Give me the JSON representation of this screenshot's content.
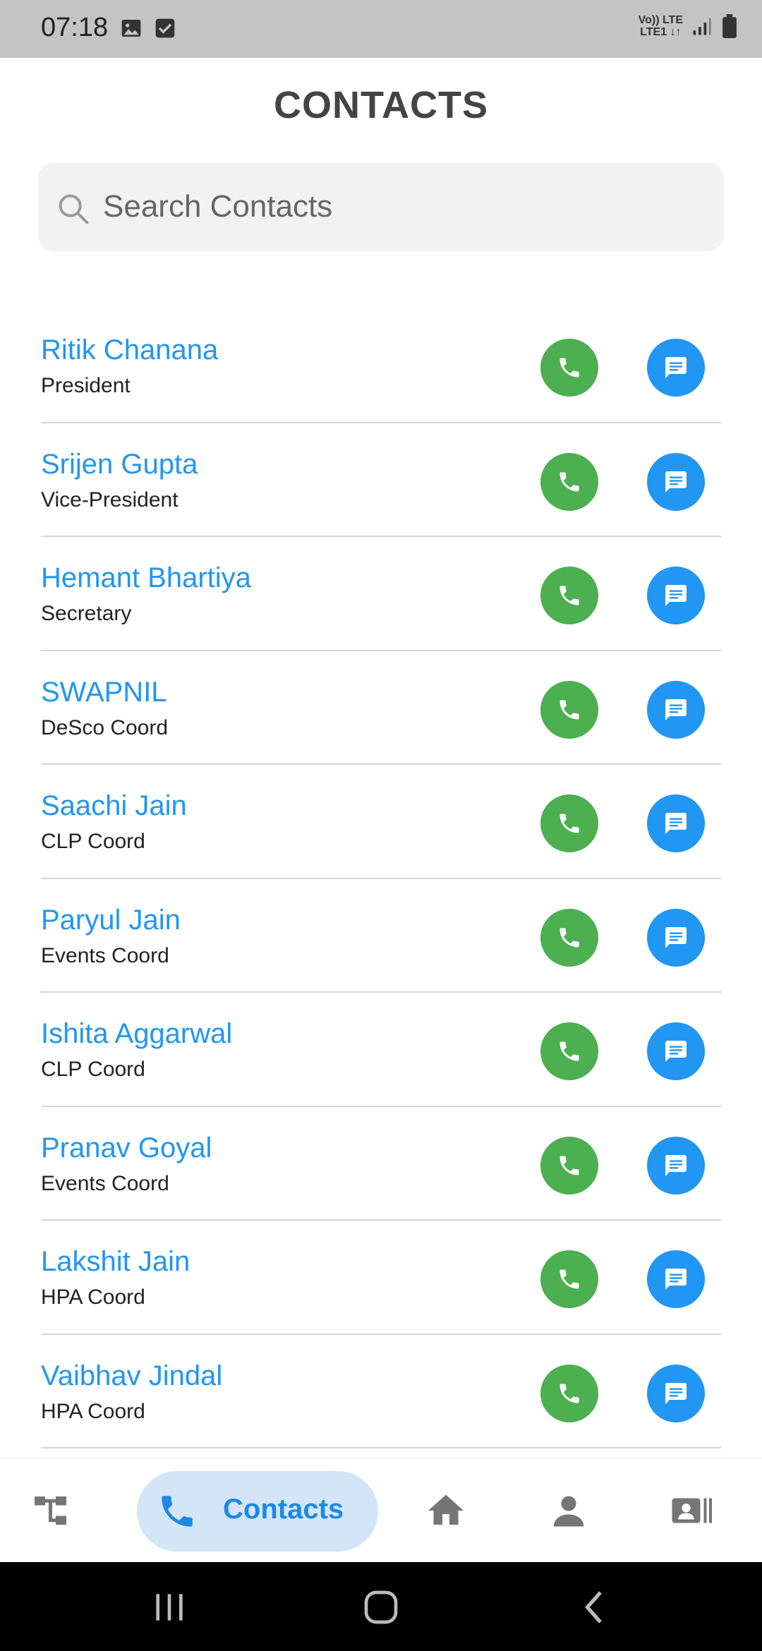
{
  "status_bar": {
    "time": "07:18",
    "left_icons": [
      "image-icon",
      "checkbox-icon"
    ],
    "network_line1": "Vo)) LTE",
    "network_line2": "LTE1 ↓↑",
    "right_icons": [
      "signal-icon",
      "battery-icon"
    ]
  },
  "header": {
    "title": "CONTACTS"
  },
  "search": {
    "placeholder": "Search Contacts",
    "value": ""
  },
  "contacts": [
    {
      "name": "Ritik Chanana",
      "role": "President"
    },
    {
      "name": "Srijen Gupta",
      "role": "Vice-President"
    },
    {
      "name": "Hemant Bhartiya",
      "role": "Secretary"
    },
    {
      "name": "SWAPNIL",
      "role": "DeSco Coord"
    },
    {
      "name": "Saachi Jain",
      "role": "CLP Coord"
    },
    {
      "name": "Paryul Jain",
      "role": "Events Coord"
    },
    {
      "name": "Ishita Aggarwal",
      "role": "CLP Coord"
    },
    {
      "name": "Pranav Goyal",
      "role": "Events Coord"
    },
    {
      "name": "Lakshit Jain",
      "role": "HPA Coord"
    },
    {
      "name": "Vaibhav Jindal",
      "role": "HPA Coord"
    }
  ],
  "bottom_nav": {
    "items": [
      {
        "icon": "hierarchy-icon",
        "label": ""
      },
      {
        "icon": "phone-icon",
        "label": "Contacts",
        "active": true
      },
      {
        "icon": "home-icon",
        "label": ""
      },
      {
        "icon": "person-icon",
        "label": ""
      },
      {
        "icon": "contact-card-icon",
        "label": ""
      }
    ]
  },
  "colors": {
    "accent_blue": "#2196f3",
    "call_green": "#4caf50",
    "active_nav_bg": "#d3e6f8",
    "status_bar_bg": "#c4c4c4"
  }
}
